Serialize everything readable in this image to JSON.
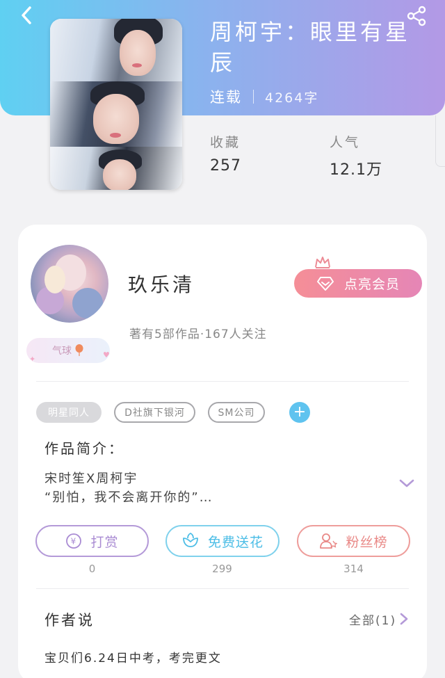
{
  "header": {
    "title": "周柯宇：眼里有星辰",
    "status": "连载",
    "word_count": "4264字",
    "stats": [
      {
        "label": "收藏",
        "value": "257"
      },
      {
        "label": "人气",
        "value": "12.1万"
      }
    ]
  },
  "author": {
    "name": "玖乐清",
    "meta": "著有5部作品·167人关注",
    "badge": "气球",
    "vip_label": "点亮会员"
  },
  "tags": [
    "明星同人",
    "D社旗下银河",
    "SM公司"
  ],
  "intro": {
    "title": "作品简介：",
    "line1": "宋时笙X周柯宇",
    "line2": "“别怕，我不会离开你的”…"
  },
  "actions": [
    {
      "label": "打赏",
      "count": "0"
    },
    {
      "label": "免费送花",
      "count": "299"
    },
    {
      "label": "粉丝榜",
      "count": "314"
    }
  ],
  "author_says": {
    "title": "作者说",
    "all_label": "全部(1)",
    "text": "宝贝们6.24日中考，考完更文"
  },
  "colors": {
    "header_start": "#5fd0f2",
    "header_end": "#b399e6",
    "vip_gradient_start": "#f58e97",
    "vip_gradient_end": "#e586b6",
    "reward": "#a98bd3",
    "flower": "#4bbde6",
    "fans": "#e98886",
    "tag_add": "#5fc3ef"
  }
}
